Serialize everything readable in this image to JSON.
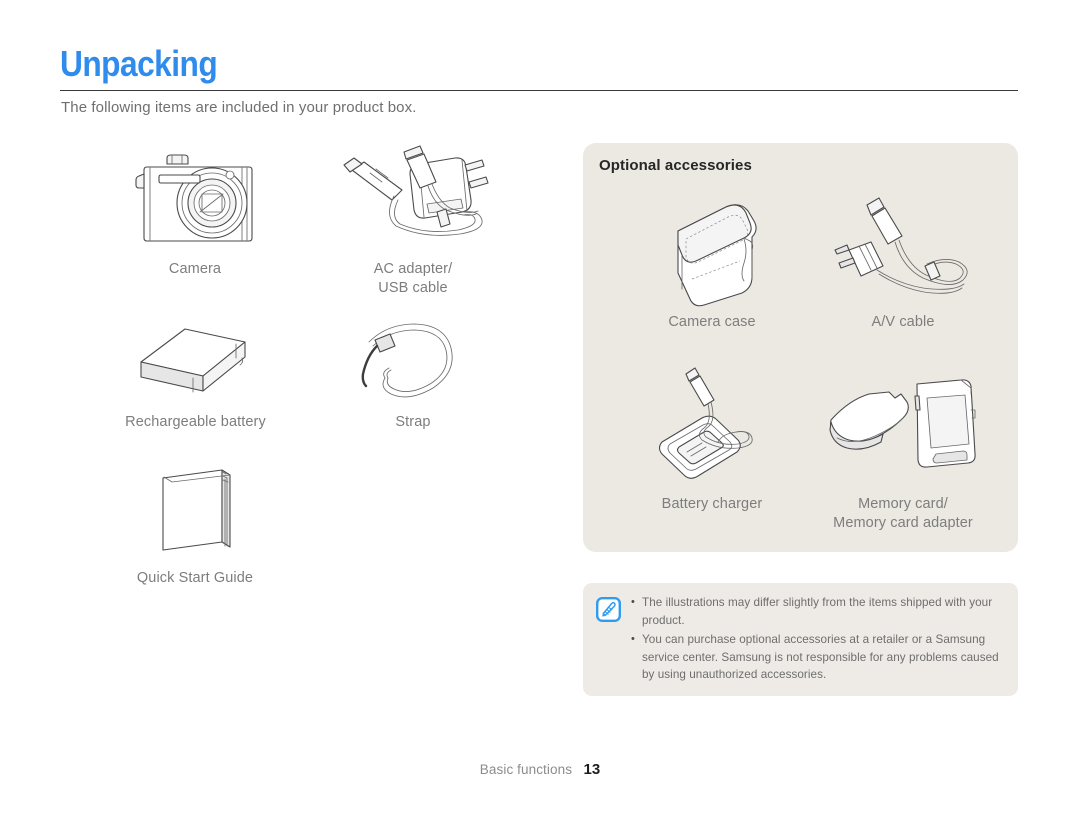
{
  "page": {
    "heading": "Unpacking",
    "intro": "The following items are included in your product box."
  },
  "included_items": [
    {
      "caption": "Camera",
      "icon": "camera-icon"
    },
    {
      "caption": "AC adapter/\nUSB cable",
      "icon": "ac-adapter-usb-cable-icon"
    },
    {
      "caption": "Rechargeable battery",
      "icon": "rechargeable-battery-icon"
    },
    {
      "caption": "Strap",
      "icon": "strap-icon"
    },
    {
      "caption": "Quick Start Guide",
      "icon": "quick-start-guide-icon"
    }
  ],
  "optional": {
    "title": "Optional accessories",
    "items": [
      {
        "caption": "Camera case",
        "icon": "camera-case-icon"
      },
      {
        "caption": "A/V cable",
        "icon": "av-cable-icon"
      },
      {
        "caption": "Battery charger",
        "icon": "battery-charger-icon"
      },
      {
        "caption": "Memory card/\nMemory card adapter",
        "icon": "memory-card-icon"
      }
    ]
  },
  "note": {
    "icon": "note-pen-icon",
    "bullet": "•",
    "items": [
      "The illustrations may differ slightly from the items shipped with your product.",
      "You can purchase optional accessories at a retailer or a Samsung service center. Samsung is not responsible for any problems caused by using unauthorized accessories."
    ]
  },
  "footer": {
    "section": "Basic functions",
    "page_number": "13"
  },
  "colors": {
    "heading_blue": "#2f8ced",
    "panel_beige": "#ece9e3",
    "note_beige": "#eeebe6",
    "caption_gray": "#7d7d7d",
    "note_icon_blue": "#2f9cf0"
  }
}
